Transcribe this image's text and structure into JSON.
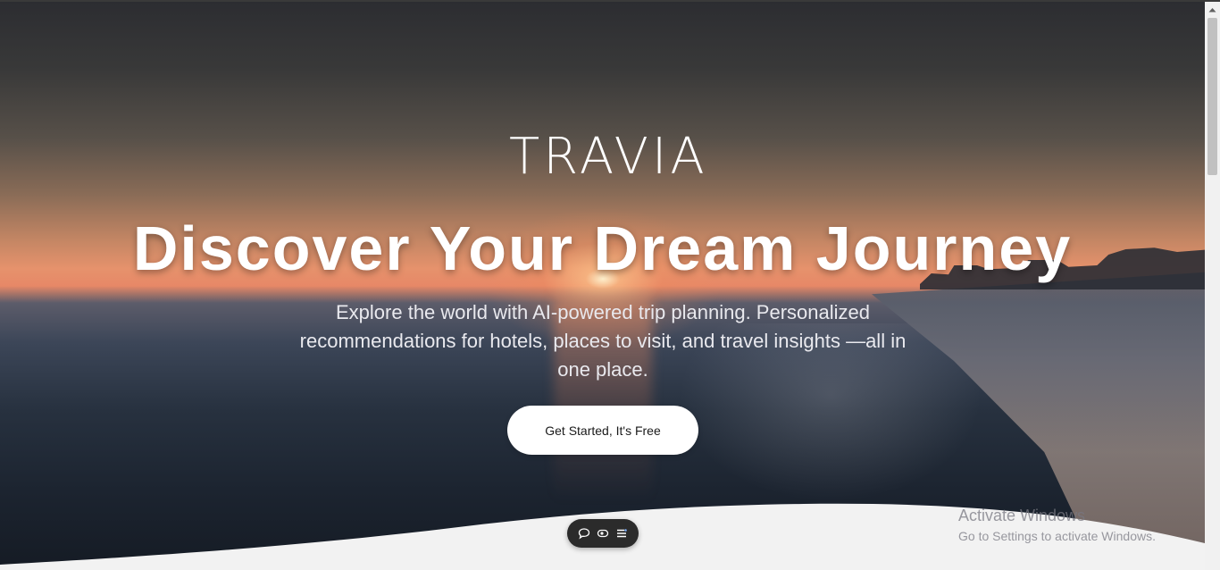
{
  "hero": {
    "brand": "TRAVIA",
    "headline": "Discover Your Dream Journey",
    "subtitle": "Explore the world with AI-powered trip planning. Personalized recommendations for hotels, places to visit, and travel insights —all in one place.",
    "cta_label": "Get Started, It's Free"
  },
  "toolbar": {
    "icons": [
      "chat-bubble-icon",
      "eye-icon",
      "list-settings-icon"
    ]
  },
  "watermark": {
    "title": "Activate Windows",
    "subtitle": "Go to Settings to activate Windows."
  },
  "colors": {
    "cta_background": "#ffffff",
    "toolbar_background": "#2b2b2b",
    "wave_fill": "#f2f2f2"
  }
}
